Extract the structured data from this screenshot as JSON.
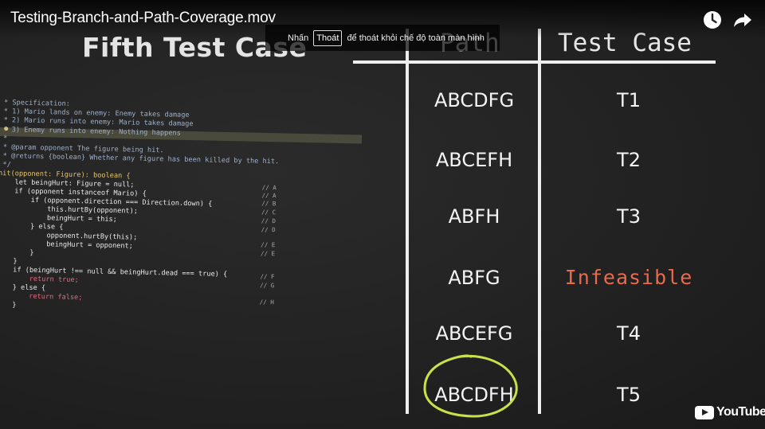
{
  "player": {
    "title": "Testing-Branch-and-Path-Coverage.mov",
    "fullscreen_hint": {
      "prefix": "Nhấn",
      "key": "Thoát",
      "suffix": "để thoát khỏi chế độ toàn màn hình"
    },
    "icons": [
      "clock-icon",
      "share-arrow-icon"
    ],
    "brand": "YouTube"
  },
  "slide": {
    "title": "Fifth Test Case",
    "code_lines": [
      " * Specification:",
      " * 1) Mario lands on enemy: Enemy takes damage",
      " * 2) Mario runs into enemy: Mario takes damage",
      " * 3) Enemy runs into enemy: Nothing happens",
      " *",
      " * @param opponent The figure being hit.",
      " * @returns {boolean} Whether any figure has been killed by the hit.",
      " */",
      "hit(opponent: Figure): boolean {",
      "    let beingHurt: Figure = null;",
      "    if (opponent instanceof Mario) {",
      "        if (opponent.direction === Direction.down) {",
      "            this.hurtBy(opponent);",
      "            beingHurt = this;",
      "        } else {",
      "            opponent.hurtBy(this);",
      "            beingHurt = opponent;",
      "        }",
      "    }",
      "    if (beingHurt !== null && beingHurt.dead === true) {",
      "        return true;",
      "    } else {",
      "        return false;",
      "    }",
      "}"
    ],
    "branch_labels": [
      "// A",
      "// A",
      "// B",
      "// C",
      "// D",
      "// D",
      "// E",
      "// E",
      "// F",
      "// G",
      "// H"
    ],
    "table": {
      "headers": [
        "Path",
        "Test Case"
      ],
      "rows": [
        {
          "path": "ABCDFG",
          "test_case": "T1"
        },
        {
          "path": "ABCEFH",
          "test_case": "T2"
        },
        {
          "path": "ABFH",
          "test_case": "T3"
        },
        {
          "path": "ABFG",
          "test_case": "Infeasible"
        },
        {
          "path": "ABCEFG",
          "test_case": "T4"
        },
        {
          "path": "ABCDFH",
          "test_case": "T5"
        }
      ],
      "circled_path": "ABCDFH"
    }
  },
  "colors": {
    "infeasible": "#e86a4b",
    "circle": "#c8e04a",
    "rules": "#eeeeee"
  }
}
